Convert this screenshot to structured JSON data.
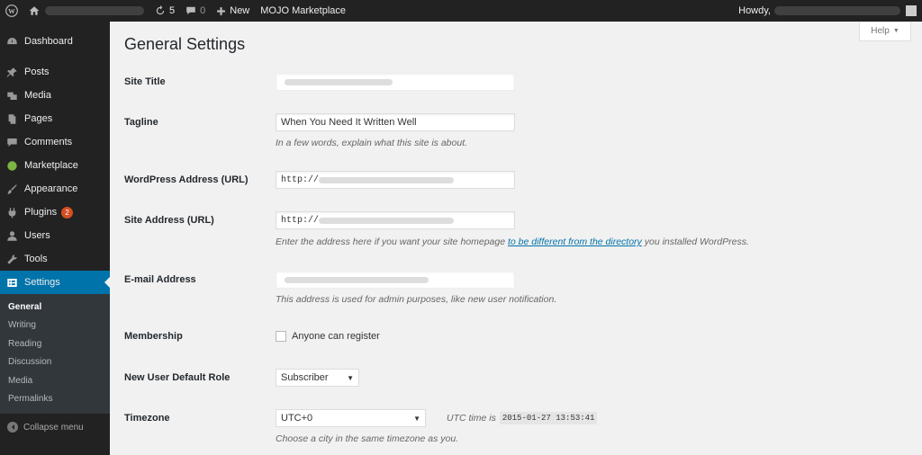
{
  "adminbar": {
    "updates_count": "5",
    "comments_count": "0",
    "new_label": "New",
    "mojo_label": "MOJO Marketplace",
    "howdy_label": "Howdy,"
  },
  "sidebar": {
    "items": [
      {
        "label": "Dashboard",
        "icon": "dashboard-icon"
      },
      {
        "label": "Posts",
        "icon": "pin-icon"
      },
      {
        "label": "Media",
        "icon": "media-icon"
      },
      {
        "label": "Pages",
        "icon": "pages-icon"
      },
      {
        "label": "Comments",
        "icon": "comment-icon"
      },
      {
        "label": "Marketplace",
        "icon": "marketplace-icon"
      },
      {
        "label": "Appearance",
        "icon": "brush-icon"
      },
      {
        "label": "Plugins",
        "icon": "plugin-icon",
        "badge": "2"
      },
      {
        "label": "Users",
        "icon": "user-icon"
      },
      {
        "label": "Tools",
        "icon": "wrench-icon"
      },
      {
        "label": "Settings",
        "icon": "settings-icon",
        "active": true
      }
    ],
    "submenu": [
      "General",
      "Writing",
      "Reading",
      "Discussion",
      "Media",
      "Permalinks"
    ],
    "collapse_label": "Collapse menu"
  },
  "page": {
    "title": "General Settings",
    "help_label": "Help"
  },
  "fields": {
    "site_title": {
      "label": "Site Title",
      "value": ""
    },
    "tagline": {
      "label": "Tagline",
      "value": "When You Need It Written Well",
      "desc": "In a few words, explain what this site is about."
    },
    "wp_address": {
      "label": "WordPress Address (URL)",
      "value": "http://"
    },
    "site_address": {
      "label": "Site Address (URL)",
      "value": "http://",
      "desc_before": "Enter the address here if you want your site homepage ",
      "desc_link": "to be different from the directory",
      "desc_after": " you installed WordPress."
    },
    "email": {
      "label": "E-mail Address",
      "value": "",
      "desc": "This address is used for admin purposes, like new user notification."
    },
    "membership": {
      "label": "Membership",
      "checkbox_label": "Anyone can register",
      "checked": false
    },
    "default_role": {
      "label": "New User Default Role",
      "value": "Subscriber"
    },
    "timezone": {
      "label": "Timezone",
      "value": "UTC+0",
      "utc_label": "UTC time is",
      "utc_time": "2015-01-27 13:53:41",
      "desc": "Choose a city in the same timezone as you."
    }
  },
  "colors": {
    "adminbar_bg": "#222222",
    "sidebar_bg": "#222222",
    "active_menu": "#0073aa",
    "badge": "#d54e21",
    "link": "#0073aa"
  }
}
